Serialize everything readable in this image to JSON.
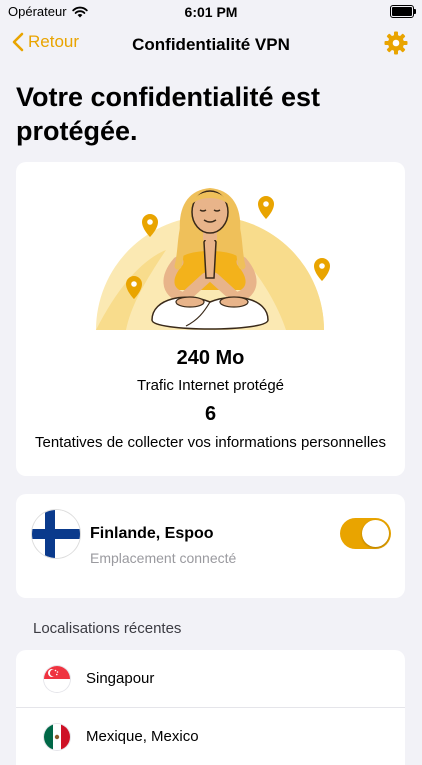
{
  "status_bar": {
    "carrier": "Opérateur",
    "time": "6:01 PM"
  },
  "nav": {
    "back_label": "Retour",
    "title": "Confidentialité VPN"
  },
  "heading": "Votre confidentialité est protégée.",
  "stats": {
    "traffic_value": "240 Mo",
    "traffic_label": "Trafic Internet protégé",
    "attempts_value": "6",
    "attempts_label": "Tentatives de collecter vos informations personnelles"
  },
  "location": {
    "name": "Finlande, Espoo",
    "status": "Emplacement connecté",
    "flag_icon": "finland-flag-icon",
    "vpn_enabled": true
  },
  "recent": {
    "header": "Localisations récentes",
    "items": [
      {
        "label": "Singapour",
        "flag_icon": "singapore-flag-icon"
      },
      {
        "label": "Mexique, Mexico",
        "flag_icon": "mexico-flag-icon"
      }
    ]
  },
  "colors": {
    "accent": "#e9a400",
    "background": "#f2f2f7",
    "card": "#ffffff",
    "secondary_text": "#9a9a9f"
  }
}
